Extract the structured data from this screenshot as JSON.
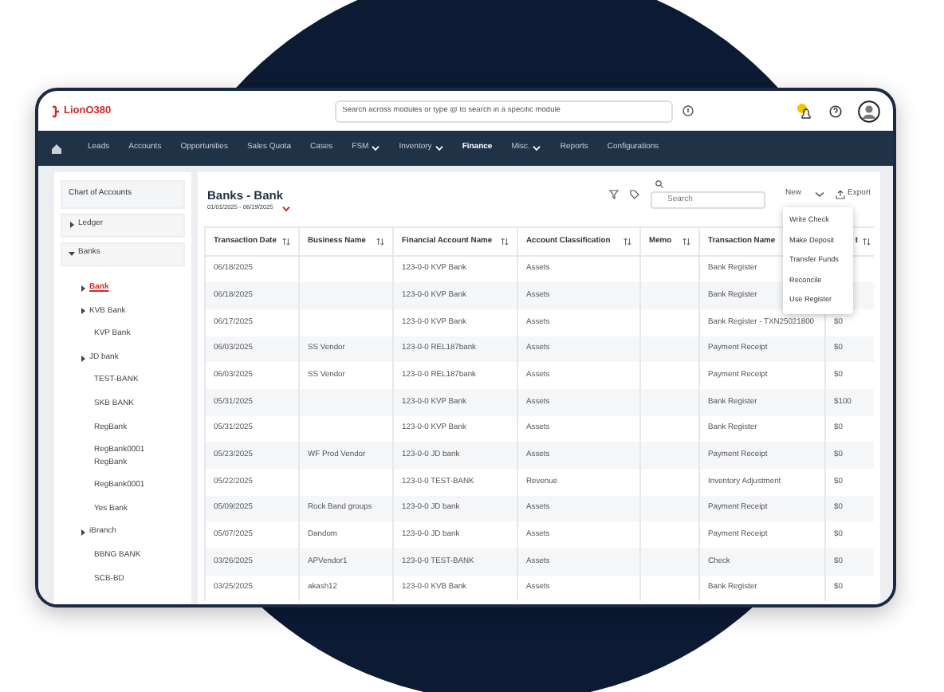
{
  "app": {
    "logo": "LionO380",
    "search": {
      "placeholder": "Search across modules or type @ to search in a specific module"
    }
  },
  "nav": [
    {
      "label": "Leads",
      "selected": false,
      "dropdown": false
    },
    {
      "label": "Accounts",
      "selected": false,
      "dropdown": false
    },
    {
      "label": "Opportunities",
      "selected": false,
      "dropdown": false
    },
    {
      "label": "Sales Quota",
      "selected": false,
      "dropdown": false
    },
    {
      "label": "Cases",
      "selected": false,
      "dropdown": false
    },
    {
      "label": "FSM",
      "selected": false,
      "dropdown": true
    },
    {
      "label": "Inventory",
      "selected": false,
      "dropdown": true
    },
    {
      "label": "Finance",
      "selected": true,
      "dropdown": false
    },
    {
      "label": "Misc.",
      "selected": false,
      "dropdown": true
    },
    {
      "label": "Reports",
      "selected": false,
      "dropdown": false
    },
    {
      "label": "Configurations",
      "selected": false,
      "dropdown": false
    }
  ],
  "sidebar": {
    "title": "Chart of Accounts",
    "items": [
      {
        "label": "Ledger",
        "expanded": false,
        "selected": false
      },
      {
        "label": "Banks",
        "expanded": true,
        "selected": false,
        "children": [
          {
            "label": "Bank",
            "expanded": false,
            "selected": true
          },
          {
            "label": "KVB Bank",
            "expanded": false,
            "selected": false
          },
          {
            "label": "KVP Bank",
            "selected": false
          },
          {
            "label": "JD bank",
            "expanded": false,
            "selected": false
          },
          {
            "label": "TEST-BANK",
            "selected": false
          },
          {
            "label": "SKB BANK",
            "selected": false
          },
          {
            "label": "RegBank",
            "selected": false
          },
          {
            "label": "RegBank0001 RegBank",
            "selected": false
          },
          {
            "label": "RegBank0001",
            "selected": false
          },
          {
            "label": "Yes Bank",
            "selected": false
          },
          {
            "label": "iBranch",
            "expanded": false,
            "selected": false
          },
          {
            "label": "BBNG BANK",
            "selected": false
          },
          {
            "label": "SCB-BD",
            "selected": false
          }
        ]
      }
    ]
  },
  "panel": {
    "title": "Banks - Bank",
    "date_range": "01/01/2025 - 06/19/2025",
    "search": {
      "placeholder": "Search"
    },
    "new_button": "New",
    "export_button": "Export",
    "new_menu": {
      "expanded": true,
      "items": [
        "Write Check",
        "Make Deposit",
        "Transfer Funds",
        "Reconcile",
        "Use Register"
      ]
    }
  },
  "table": {
    "columns": [
      "Transaction Date",
      "Business Name",
      "Financial Account Name",
      "Account Classification",
      "Memo",
      "Transaction Name",
      "t"
    ],
    "rows": [
      [
        "06/18/2025",
        "",
        "123-0-0 KVP Bank",
        "Assets",
        "",
        "Bank Register",
        null
      ],
      [
        "06/18/2025",
        "",
        "123-0-0 KVP Bank",
        "Assets",
        "",
        "Bank Register",
        null
      ],
      [
        "06/17/2025",
        "",
        "123-0-0 KVP Bank",
        "Assets",
        "",
        "Bank Register - TXN25021800",
        "$0"
      ],
      [
        "06/03/2025",
        "SS Vendor",
        "123-0-0 REL187bank",
        "Assets",
        "",
        "Payment Receipt",
        "$0"
      ],
      [
        "06/03/2025",
        "SS Vendor",
        "123-0-0 REL187bank",
        "Assets",
        "",
        "Payment Receipt",
        "$0"
      ],
      [
        "05/31/2025",
        "",
        "123-0-0 KVP Bank",
        "Assets",
        "",
        "Bank Register",
        "$100"
      ],
      [
        "05/31/2025",
        "",
        "123-0-0 KVP Bank",
        "Assets",
        "",
        "Bank Register",
        "$0"
      ],
      [
        "05/23/2025",
        "WF Prod Vendor",
        "123-0-0 JD bank",
        "Assets",
        "",
        "Payment Receipt",
        "$0"
      ],
      [
        "05/22/2025",
        "",
        "123-0-0 TEST-BANK",
        "Revenue",
        "",
        "Inventory Adjustment",
        "$0"
      ],
      [
        "05/09/2025",
        "Rock Band groups",
        "123-0-0 JD bank",
        "Assets",
        "",
        "Payment Receipt",
        "$0"
      ],
      [
        "05/07/2025",
        "Dandom",
        "123-0-0 JD bank",
        "Assets",
        "",
        "Payment Receipt",
        "$0"
      ],
      [
        "03/26/2025",
        "APVendor1",
        "123-0-0 TEST-BANK",
        "Assets",
        "",
        "Check",
        "$0"
      ],
      [
        "03/25/2025",
        "akash12",
        "123-0-0 KVB Bank",
        "Assets",
        "",
        "Bank Register",
        "$0"
      ]
    ]
  }
}
